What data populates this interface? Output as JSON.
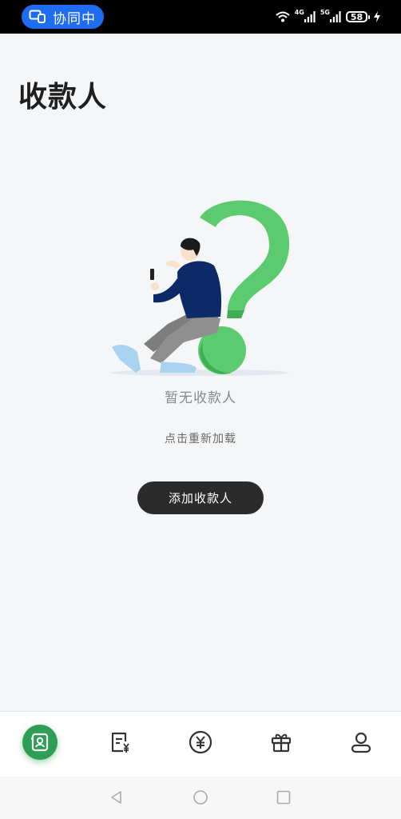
{
  "status_bar": {
    "collab_label": "协同中",
    "signal_1": "4G",
    "signal_2": "5G",
    "battery": "58"
  },
  "header": {
    "title": "收款人"
  },
  "empty_state": {
    "title": "暂无收款人",
    "reload": "点击重新加载",
    "add_button": "添加收款人"
  },
  "bottom_nav": {
    "items": [
      {
        "icon": "payee-contacts-icon",
        "active": true
      },
      {
        "icon": "bill-yuan-icon",
        "active": false
      },
      {
        "icon": "currency-yuan-icon",
        "active": false
      },
      {
        "icon": "gift-icon",
        "active": false
      },
      {
        "icon": "profile-icon",
        "active": false
      }
    ]
  },
  "colors": {
    "accent_green": "#2e9e57",
    "button_dark": "#2b2b2b",
    "collab_blue": "#1d6cf2"
  }
}
